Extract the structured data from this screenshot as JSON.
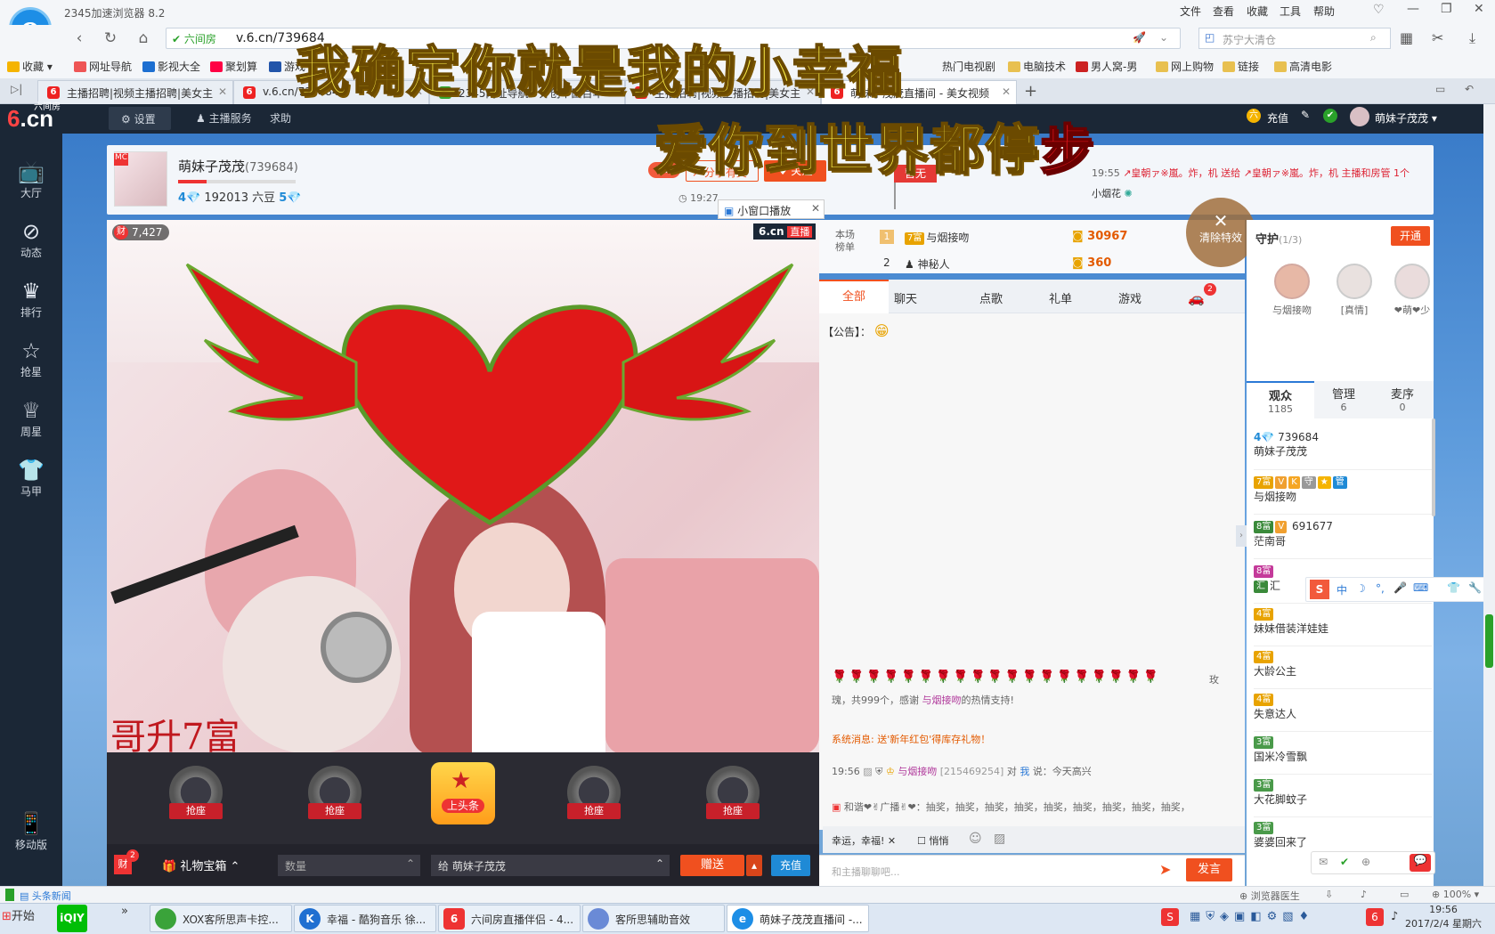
{
  "browser": {
    "title": "2345加速浏览器 8.2",
    "menus": [
      "文件",
      "查看",
      "收藏",
      "工具",
      "帮助"
    ],
    "site_badge": "六间房",
    "url": "v.6.cn/739684",
    "search_placeholder": "苏宁大清仓",
    "favorites": [
      "收藏",
      "网址导航",
      "影视大全",
      "聚划算",
      "游戏",
      "热门电视剧",
      "电脑技术",
      "男人窝-男",
      "网上购物",
      "链接",
      "高清电影"
    ],
    "tabs": [
      "主播招聘|视频主播招聘|美女主",
      "v.6.cn/739684",
      "2345网址导航 - 开创中国百年",
      "主播招聘|视频主播招聘|美女主",
      "萌妹子茂茂直播间 - 美女视频"
    ]
  },
  "site": {
    "logo_top": "六间房",
    "logo": "6.cn",
    "settings": "设置",
    "anchor_service": "主播服务",
    "help": "求助",
    "recharge": "充值",
    "username": "萌妹子茂茂",
    "nav": [
      {
        "label": "大厅",
        "icon": "tv-icon"
      },
      {
        "label": "动态",
        "icon": "compass-icon"
      },
      {
        "label": "排行",
        "icon": "crown-icon"
      },
      {
        "label": "抢星",
        "icon": "star-icon"
      },
      {
        "label": "周星",
        "icon": "cup-icon"
      },
      {
        "label": "马甲",
        "icon": "shirt-icon"
      }
    ],
    "mobile": "移动版"
  },
  "room": {
    "anchor_name": "萌妹子茂茂",
    "anchor_id": "(739684)",
    "level": "4",
    "level2": "5",
    "beans": "192013 六豆",
    "hot": "hot",
    "share": "分享有奖",
    "follow": "关注",
    "time_start": "19:27",
    "mini_window": "小窗口播放",
    "no_gift": "暂无",
    "announce_time": "19:55",
    "announce_text": "↗皇朝ァ※嵐。炸，机 送给 ↗皇朝ァ※嵐。炸，机 主播和房管 1个",
    "announce_gift": "小烟花",
    "clear_effects": "清除特效",
    "wealth": "7,427",
    "live_brand": "6.cn",
    "live_tag": "直播",
    "overlay_text": "哥升7富"
  },
  "lyrics": {
    "line1": "我确定你就是我的小幸福",
    "line2_main": "爱你到世界都停",
    "line2_last": "步"
  },
  "seats": [
    "抢座",
    "抢座",
    "上头条",
    "抢座",
    "抢座"
  ],
  "gift": {
    "box": "礼物宝箱",
    "qty_placeholder": "数量",
    "to_label": "给",
    "to_name": "萌妹子茂茂",
    "send": "赠送",
    "recharge": "充值",
    "box_count": "2"
  },
  "rank": {
    "title": "本场榜单",
    "rows": [
      {
        "rank": "1",
        "name": "与烟接吻",
        "badge": "7富",
        "score": "30967"
      },
      {
        "rank": "2",
        "name": "神秘人",
        "badge": "",
        "score": "360"
      }
    ]
  },
  "chat": {
    "tabs": [
      "全部",
      "聊天",
      "点歌",
      "礼单",
      "游戏"
    ],
    "car_count": "2",
    "notice": "【公告】：",
    "gift_msg_tail": "玫",
    "gift_msg_2": "瑰，共999个，感谢",
    "gift_msg_user": "与烟接吻",
    "gift_msg_end": "的热情支持!",
    "system": "系统消息: 送'新年红包'得库存礼物！",
    "msg_time": "19:56",
    "msg_user": "与烟接吻",
    "msg_id": "[215469254]",
    "msg_to": "对",
    "msg_target": "我",
    "msg_text": "说：今天高兴",
    "broadcast": "和谐❤✌广播✌❤：抽奖，抽奖，抽奖，抽奖，抽奖，抽奖，抽奖，抽奖，抽奖，",
    "quick_text": "幸运，幸福!",
    "whisper": "悄悄",
    "input_placeholder": "和主播聊聊吧...",
    "send": "发言"
  },
  "guard": {
    "title": "守护",
    "count": "(1/3)",
    "open": "开通",
    "members": [
      "与烟接吻",
      "[真情]",
      "❤萌❤少"
    ]
  },
  "audience_tabs": [
    {
      "label": "观众",
      "count": "1185"
    },
    {
      "label": "管理",
      "count": "6"
    },
    {
      "label": "麦序",
      "count": "0"
    }
  ],
  "audience": [
    {
      "badge": "4",
      "line1": "739684",
      "name": "萌妹子茂茂"
    },
    {
      "badge": "7富",
      "line1": "",
      "name": "与烟接吻"
    },
    {
      "badge": "8富",
      "line1": "691677",
      "name": "茫南哥"
    },
    {
      "badge": "8富",
      "line1": "",
      "name": "汇"
    },
    {
      "badge": "4富",
      "line1": "",
      "name": "妹妹借装洋娃娃"
    },
    {
      "badge": "4富",
      "line1": "",
      "name": "大龄公主"
    },
    {
      "badge": "4富",
      "line1": "",
      "name": "失意达人"
    },
    {
      "badge": "3富",
      "line1": "",
      "name": "国米冷雪飘"
    },
    {
      "badge": "3富",
      "line1": "",
      "name": "大花脚蚊子"
    },
    {
      "badge": "3富",
      "line1": "",
      "name": "婆婆回来了"
    }
  ],
  "ime": [
    "中",
    "☽",
    "°,",
    "🎤",
    "⌨",
    "👕",
    "🔧"
  ],
  "status": {
    "news": "头条新闻",
    "doctor": "浏览器医生",
    "zoom": "100%"
  },
  "taskbar": {
    "start": "开始",
    "tasks": [
      "XOX客所思声卡控...",
      "幸福 - 酷狗音乐 徐...",
      "六间房直播伴侣 - 4...",
      "客所思辅助音效",
      "萌妹子茂茂直播间 -..."
    ],
    "time": "19:56",
    "date": "2017/2/4 星期六"
  },
  "colors": {
    "accent": "#f0501f",
    "nav": "#1b2736",
    "lyric": "#fff24a"
  }
}
